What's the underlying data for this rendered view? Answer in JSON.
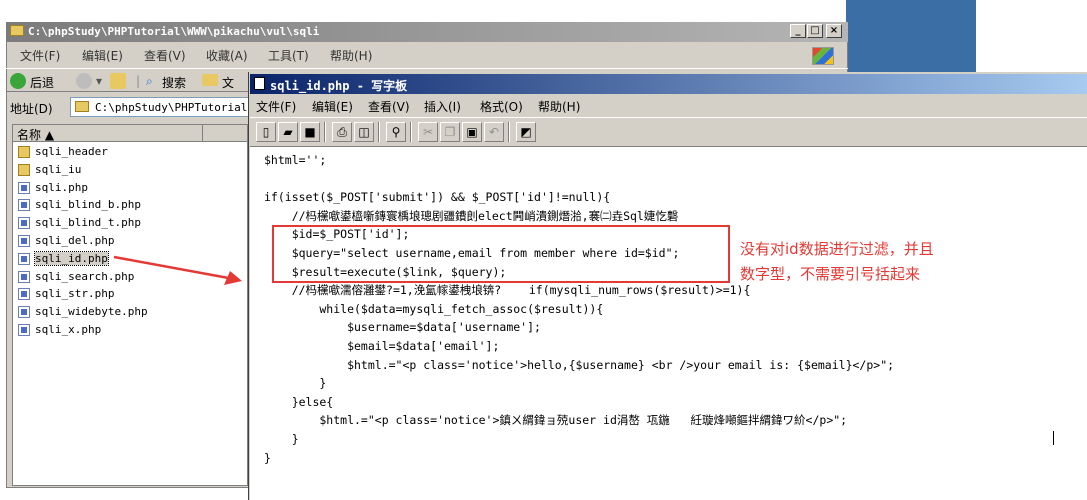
{
  "explorer": {
    "title": "C:\\phpStudy\\PHPTutorial\\WWW\\pikachu\\vul\\sqli",
    "menu": [
      "文件(F)",
      "编辑(E)",
      "查看(V)",
      "收藏(A)",
      "工具(T)",
      "帮助(H)"
    ],
    "toolbar": {
      "back": "后退",
      "search": "搜索",
      "folders_partial": "文"
    },
    "address_label": "地址(D)",
    "address_value": "C:\\phpStudy\\PHPTutorial\\W",
    "column_name": "名称 ▲",
    "files": [
      {
        "name": "sqli_header",
        "type": "folder"
      },
      {
        "name": "sqli_iu",
        "type": "folder"
      },
      {
        "name": "sqli.php",
        "type": "php"
      },
      {
        "name": "sqli_blind_b.php",
        "type": "php"
      },
      {
        "name": "sqli_blind_t.php",
        "type": "php"
      },
      {
        "name": "sqli_del.php",
        "type": "php"
      },
      {
        "name": "sqli_id.php",
        "type": "php",
        "selected": true
      },
      {
        "name": "sqli_search.php",
        "type": "php"
      },
      {
        "name": "sqli_str.php",
        "type": "php"
      },
      {
        "name": "sqli_widebyte.php",
        "type": "php"
      },
      {
        "name": "sqli_x.php",
        "type": "php"
      }
    ]
  },
  "wordpad": {
    "title": "sqli_id.php - 写字板",
    "menu": [
      "文件(F)",
      "编辑(E)",
      "查看(V)",
      "插入(I)",
      "格式(O)",
      "帮助(H)"
    ],
    "code_lines": [
      "$html='';",
      "",
      "if(isset($_POST['submit']) && $_POST['id']!=null){",
      "    //杩欓噷鍙橀噺鏄寰楀埌璁剧疆鐨剆elect闁峭潰鍘熸湁,褰㈡垚Sql婕忔礊",
      "    $id=$_POST['id'];",
      "    $query=\"select username,email from member where id=$id\";",
      "    $result=execute($link, $query);",
      "    //杩欓噷濡傛灉鐢?=1,浼氳幏鍙栧埌锛?    if(mysqli_num_rows($result)>=1){",
      "        while($data=mysqli_fetch_assoc($result)){",
      "            $username=$data['username'];",
      "            $email=$data['email'];",
      "            $html.=\"<p class='notice'>hello,{$username} <br />your email is: {$email}</p>\";",
      "        }",
      "    }else{",
      "        $html.=\"<p class='notice'>鎮ㄨ緭鍏ョ殑user id涓嶅 瓨鍦   紝璇烽噸鏂拌緭鍏ワ紒</p>\";",
      "    }",
      "}"
    ]
  },
  "annotation": {
    "line1": "没有对id数据进行过滤，并且",
    "line2": "数字型，不需要引号括起来",
    "color": "#e53935"
  }
}
